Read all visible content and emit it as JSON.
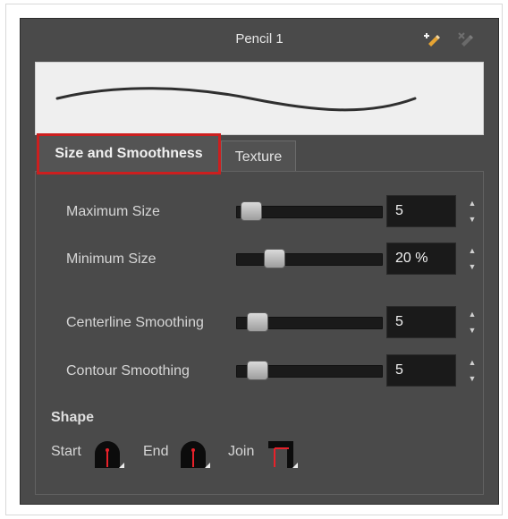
{
  "panel": {
    "title": "Pencil 1"
  },
  "toolbar": {
    "new_icon": "new-brush-icon",
    "delete_icon": "delete-brush-icon"
  },
  "tabs": [
    {
      "label": "Size and Smoothness",
      "active": true
    },
    {
      "label": "Texture",
      "active": false
    }
  ],
  "sliders": [
    {
      "label": "Maximum Size",
      "value": "5",
      "level": 0.0
    },
    {
      "label": "Minimum Size",
      "value": "20 %",
      "level": 0.2
    },
    {
      "label": "Centerline Smoothing",
      "value": "5",
      "level": 0.05
    },
    {
      "label": "Contour Smoothing",
      "value": "5",
      "level": 0.05
    }
  ],
  "spinner": {
    "up": "▲",
    "down": "▼"
  },
  "shape": {
    "title": "Shape",
    "start_label": "Start",
    "end_label": "End",
    "join_label": "Join",
    "start_icon": "round-cap-icon",
    "end_icon": "round-cap-icon",
    "join_icon": "miter-join-icon"
  },
  "colors": {
    "panel_bg": "#4a4a4a",
    "highlight": "#cc1f1f",
    "shape_marker": "#e8212a"
  }
}
